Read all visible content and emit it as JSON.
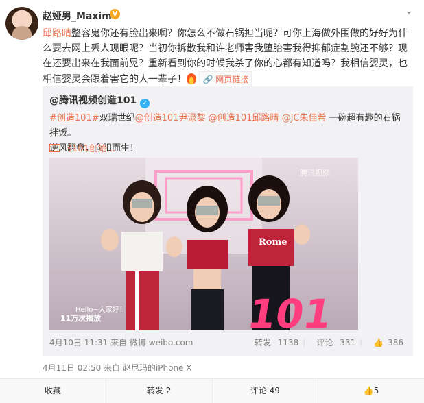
{
  "post": {
    "author": "赵娅男_Maxim",
    "verified_badge": "V",
    "more_icon": "chevron-down-icon",
    "mention1": "邱路晴",
    "text1": "整容鬼你还有脸出来啊？你怎么不做石锅担当呢？可你上海做外围做的好好为什么要去网上丢人现眼呢？当初你拆散我和许老师害我堕胎害我得抑郁症割腕还不够？现在还要出来在我面前晃？重新看到你的时候我杀了你的心都有知道吗？我相信婴灵，也相信婴灵会跟着害它的人一辈子！",
    "weblink": "网页链接",
    "meta": "4月11日 02:50 来自 赵尼玛的iPhone X"
  },
  "retweet": {
    "author": "@腾讯视频创造101",
    "text_parts": [
      "#创造101#",
      "双瑞世纪",
      "@创造101尹渌黎",
      " ",
      "@创造101",
      "邱路晴",
      " ",
      "@JC朱佳希",
      " 一碗超有趣的石锅拌饭。"
    ],
    "line2": "逆风翻盘，向阳而生！",
    "video_link": "《101创始...",
    "video_overlay_plays": "11万次播放",
    "video_overlay_hello": "Hello~大家好！",
    "video_shirt": "Rome",
    "video_logo": "腾讯视频",
    "video_big_text": "101",
    "meta": "4月10日 11:31 来自 微博 weibo.com",
    "stats": {
      "forward_label": "转发",
      "forward": "1138",
      "comment_label": "评论",
      "comment": "331",
      "like": "386"
    }
  },
  "actions": {
    "collect": "收藏",
    "forward": "转发 2",
    "comment": "评论 49",
    "like": "5"
  },
  "colors": {
    "accent": "#eb7350",
    "verified": "#f5a623",
    "verified_blue": "#32b2f5"
  }
}
